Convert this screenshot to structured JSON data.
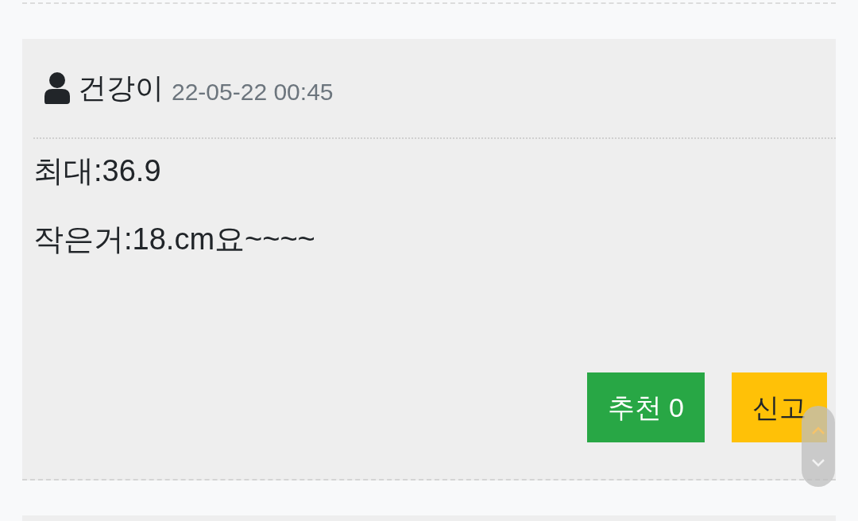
{
  "comment": {
    "author": "건강이",
    "datetime": "22-05-22 00:45",
    "lines": [
      "최대:36.9",
      "작은거:18.cm요~~~~"
    ],
    "buttons": [
      {
        "label": "추천 0",
        "kind": "recommend"
      },
      {
        "label": "신고",
        "kind": "report"
      }
    ]
  }
}
